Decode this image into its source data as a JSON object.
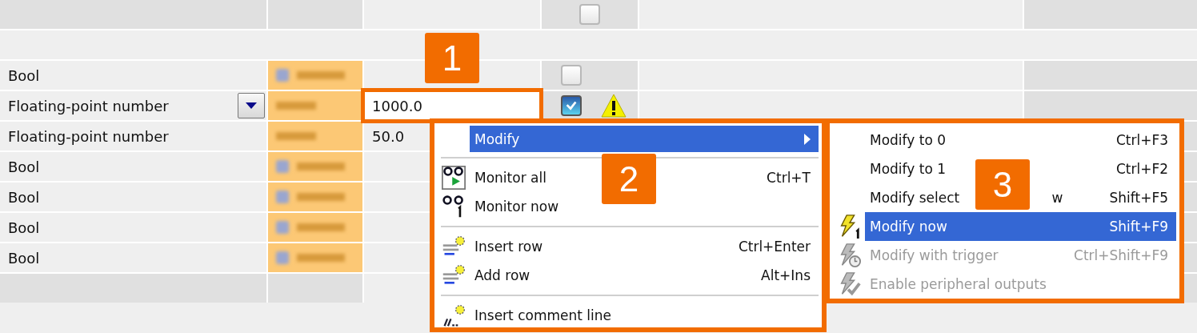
{
  "table": {
    "top_row": {
      "checkbox": {
        "checked": false
      }
    },
    "rows": [
      {
        "type": "Bool",
        "kind": "bool",
        "checkbox": {
          "checked": false
        }
      },
      {
        "type": "Floating-point number",
        "dropdown": true,
        "kind": "number",
        "modify_value": "1000.0",
        "editing": true,
        "checkbox": {
          "checked": true
        },
        "warning": true
      },
      {
        "type": "Floating-point number",
        "kind": "number",
        "modify_value": "50.0"
      },
      {
        "type": "Bool",
        "kind": "bool"
      },
      {
        "type": "Bool",
        "kind": "bool"
      },
      {
        "type": "Bool",
        "kind": "bool"
      },
      {
        "type": "Bool",
        "kind": "bool"
      }
    ]
  },
  "context_menu": {
    "items": [
      {
        "kind": "submenu",
        "label": "Modify",
        "selected": true
      },
      {
        "kind": "separator"
      },
      {
        "kind": "item",
        "label": "Monitor all",
        "shortcut": "Ctrl+T",
        "selected": false
      },
      {
        "kind": "item",
        "label": "Monitor now",
        "selected": false
      },
      {
        "kind": "separator"
      },
      {
        "kind": "item",
        "label": "Insert row",
        "shortcut": "Ctrl+Enter",
        "selected": false
      },
      {
        "kind": "item",
        "label": "Add row",
        "shortcut": "Alt+Ins",
        "selected": false
      },
      {
        "kind": "separator"
      },
      {
        "kind": "item",
        "label": "Insert comment line",
        "selected": false
      }
    ]
  },
  "submenu": {
    "items": [
      {
        "label": "Modify to 0",
        "shortcut": "Ctrl+F3",
        "selected": false,
        "disabled": false
      },
      {
        "label": "Modify to 1",
        "shortcut": "Ctrl+F2",
        "selected": false,
        "disabled": false
      },
      {
        "label": "Modify select",
        "label_tail": "w",
        "shortcut": "Shift+F5",
        "selected": false,
        "disabled": false
      },
      {
        "label": "Modify now",
        "shortcut": "Shift+F9",
        "selected": true,
        "disabled": false
      },
      {
        "label": "Modify with trigger",
        "shortcut": "Ctrl+Shift+F9",
        "selected": false,
        "disabled": true
      },
      {
        "label": "Enable peripheral outputs",
        "selected": false,
        "disabled": true
      }
    ]
  },
  "callouts": [
    {
      "number": "1"
    },
    {
      "number": "2"
    },
    {
      "number": "3"
    }
  ]
}
